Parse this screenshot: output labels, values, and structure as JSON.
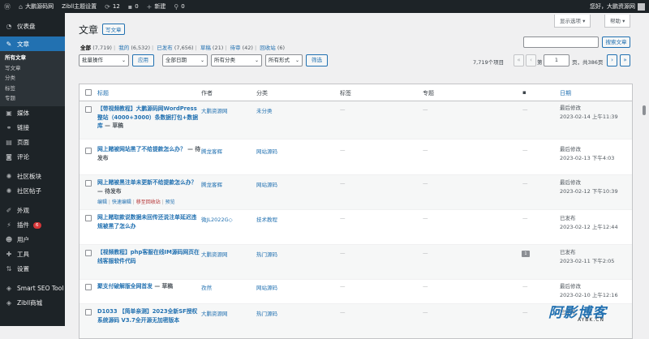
{
  "adminbar": {
    "site_name": "大鹏源码网",
    "theme_settings": "Zibll主题设置",
    "updates_count": "12",
    "comments_count": "0",
    "new_label": "新建",
    "links_count": "0",
    "greeting": "您好，大鹏资源网"
  },
  "sidebar": {
    "items": [
      {
        "label": "仪表盘",
        "icon": "dashboard-icon"
      },
      {
        "label": "文章",
        "icon": "pin-icon",
        "active": true
      },
      {
        "label": "媒体",
        "icon": "media-icon"
      },
      {
        "label": "链接",
        "icon": "link-icon"
      },
      {
        "label": "页面",
        "icon": "page-icon"
      },
      {
        "label": "评论",
        "icon": "comment-icon"
      },
      {
        "label": "社区板块",
        "icon": "forum-icon"
      },
      {
        "label": "社区帖子",
        "icon": "forum-post-icon"
      },
      {
        "label": "外观",
        "icon": "appearance-icon"
      },
      {
        "label": "插件",
        "icon": "plugin-icon",
        "badge": "6"
      },
      {
        "label": "用户",
        "icon": "user-icon"
      },
      {
        "label": "工具",
        "icon": "tools-icon"
      },
      {
        "label": "设置",
        "icon": "settings-icon"
      },
      {
        "label": "Smart SEO Tool",
        "icon": "seo-icon"
      },
      {
        "label": "Zibll商城",
        "icon": "shop-icon"
      }
    ],
    "submenu": [
      "所有文章",
      "写文章",
      "分类",
      "标签",
      "专题"
    ]
  },
  "header": {
    "screen_options": "显示选项",
    "help": "帮助",
    "title": "文章",
    "add_new": "写文章",
    "search_button": "搜索文章"
  },
  "views": [
    {
      "label": "全部",
      "count": "(7,719)"
    },
    {
      "label": "我的",
      "count": "(6,532)"
    },
    {
      "label": "已发布",
      "count": "(7,656)"
    },
    {
      "label": "草稿",
      "count": "(21)"
    },
    {
      "label": "待审",
      "count": "(42)"
    },
    {
      "label": "回收站",
      "count": "(6)"
    }
  ],
  "filters": {
    "bulk_action": "批量操作",
    "apply": "应用",
    "all_dates": "全部日期",
    "all_categories": "所有分类",
    "all_formats": "所有形式",
    "filter": "筛选"
  },
  "pagination": {
    "items": "7,719个项目",
    "first": "«",
    "prev": "‹",
    "page_prefix": "第",
    "current_page": "1",
    "page_suffix": "页，共386页",
    "next": "›",
    "last": "»"
  },
  "table": {
    "headers": {
      "title": "标题",
      "author": "作者",
      "categories": "分类",
      "tags": "标签",
      "topics": "专题",
      "date": "日期"
    },
    "rows": [
      {
        "title": "【带视频教程】大鹏源码网WordPress整站（4000+3000）条数据打包+数据库",
        "state": " — 草稿",
        "author": "大鹏资源网",
        "category": "未分类",
        "tags": "—",
        "topics": "—",
        "comments": "—",
        "status": "最后修改",
        "date": "2023-02-14 上午11:39"
      },
      {
        "title": "网上赌被网站黑了不给提款怎么办？",
        "state": " — 待发布",
        "author": "腾龙客辉",
        "category": "网站源码",
        "tags": "—",
        "topics": "—",
        "comments": "—",
        "status": "最后修改",
        "date": "2023-02-13 下午4:03"
      },
      {
        "title": "网上赌被黑注单未更新不给提款怎么办？",
        "state": " — 待发布",
        "author": "腾龙客辉",
        "category": "网站源码",
        "tags": "—",
        "topics": "—",
        "comments": "—",
        "status": "最后修改",
        "date": "2023-02-12 下午10:39",
        "actions": [
          "编辑",
          "快速编辑",
          "移至回收站",
          "预览"
        ]
      },
      {
        "title": "网上赌取款说数据未回传还说注单延迟违规被黑了怎么办",
        "state": "",
        "author": "微JL2022G◇",
        "category": "技术教程",
        "tags": "—",
        "topics": "—",
        "comments": "—",
        "status": "已发布",
        "date": "2023-02-12 上午12:44"
      },
      {
        "title": "【视频教程】php客服在线IM源码网页在线客服软件代码",
        "state": "",
        "author": "大鹏资源网",
        "category": "热门源码",
        "tags": "—",
        "topics": "—",
        "comments": "1",
        "status": "已发布",
        "date": "2023-02-11 下午2:05"
      },
      {
        "title": "聚支付破解版全网首发",
        "state": " — 草稿",
        "author": "孜然",
        "category": "网站源码",
        "tags": "—",
        "topics": "—",
        "comments": "—",
        "status": "最后修改",
        "date": "2023-02-10 上午12:16"
      },
      {
        "title": "D1033 【简单亲测】2023全新SF授权系统源码 V3.7全开源无加密版本",
        "state": "",
        "author": "大鹏资源网",
        "category": "热门源码",
        "tags": "—",
        "topics": "—",
        "comments": "—",
        "status": "已发布",
        "date": ""
      }
    ]
  },
  "watermark": {
    "main": "阿影博客",
    "sub": "AYBK.CN"
  },
  "colors": {
    "accent": "#2271b1",
    "sidebar_bg": "#1d2327",
    "active_menu": "#2271b1"
  }
}
